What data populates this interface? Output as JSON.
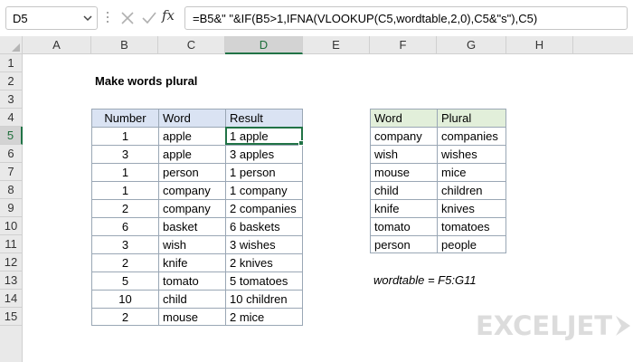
{
  "formula_bar": {
    "name_box": "D5",
    "fx_label": "fx",
    "formula": "=B5&\" \"&IF(B5>1,IFNA(VLOOKUP(C5,wordtable,2,0),C5&\"s\"),C5)"
  },
  "columns": [
    "A",
    "B",
    "C",
    "D",
    "E",
    "F",
    "G",
    "H"
  ],
  "rows": [
    "1",
    "2",
    "3",
    "4",
    "5",
    "6",
    "7",
    "8",
    "9",
    "10",
    "11",
    "12",
    "13",
    "14",
    "15"
  ],
  "title": "Make words plural",
  "main_table": {
    "headers": [
      "Number",
      "Word",
      "Result"
    ],
    "rows": [
      [
        "1",
        "apple",
        "1 apple"
      ],
      [
        "3",
        "apple",
        "3 apples"
      ],
      [
        "1",
        "person",
        "1 person"
      ],
      [
        "1",
        "company",
        "1 company"
      ],
      [
        "2",
        "company",
        "2 companies"
      ],
      [
        "6",
        "basket",
        "6 baskets"
      ],
      [
        "3",
        "wish",
        "3 wishes"
      ],
      [
        "2",
        "knife",
        "2 knives"
      ],
      [
        "5",
        "tomato",
        "5 tomatoes"
      ],
      [
        "10",
        "child",
        "10 children"
      ],
      [
        "2",
        "mouse",
        "2 mice"
      ]
    ]
  },
  "lookup_table": {
    "headers": [
      "Word",
      "Plural"
    ],
    "rows": [
      [
        "company",
        "companies"
      ],
      [
        "wish",
        "wishes"
      ],
      [
        "mouse",
        "mice"
      ],
      [
        "child",
        "children"
      ],
      [
        "knife",
        "knives"
      ],
      [
        "tomato",
        "tomatoes"
      ],
      [
        "person",
        "people"
      ]
    ]
  },
  "note": "wordtable = F5:G11",
  "logo": "EXCELJET",
  "colors": {
    "accent": "#217346",
    "main_header_fill": "#dae3f3",
    "lookup_header_fill": "#e2efda"
  },
  "active_cell": "D5"
}
